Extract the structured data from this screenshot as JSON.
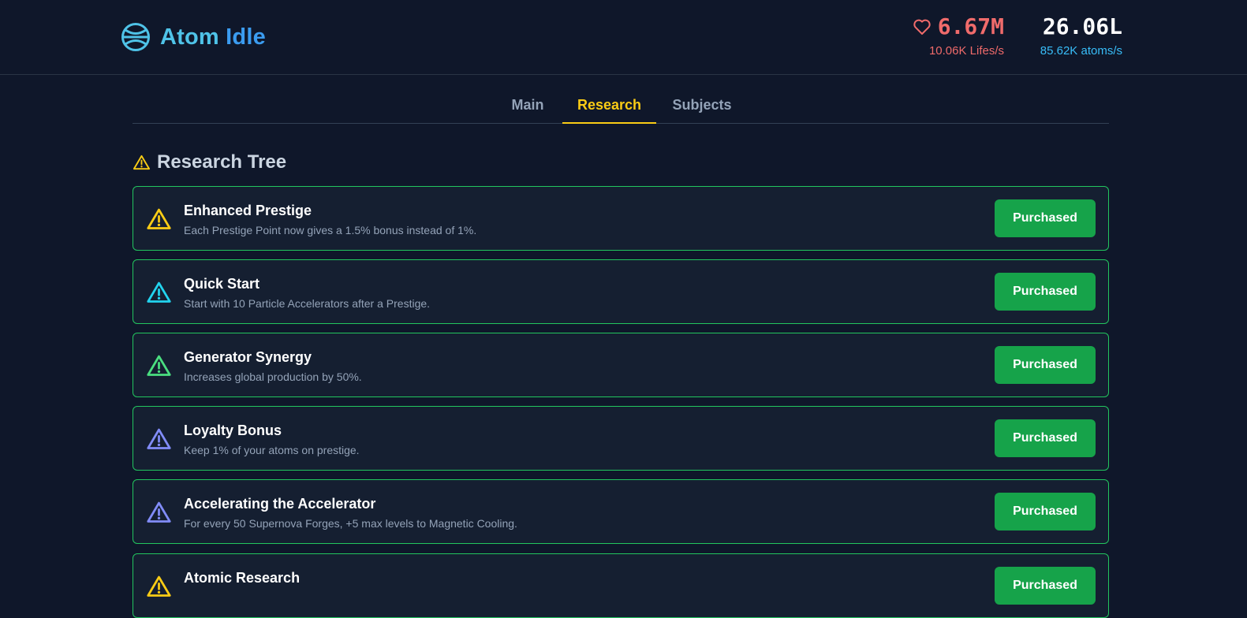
{
  "app": {
    "title_part1": "Atom",
    "title_part2": "Idle",
    "logo_icon": "atom-icon"
  },
  "stats": {
    "lives": {
      "value": "6.67M",
      "rate": "10.06K Lifes/s",
      "icon": "heart-icon",
      "color": "#f06b6b"
    },
    "atoms": {
      "value": "26.06L",
      "rate": "85.62K atoms/s",
      "color": "#38bdf8"
    }
  },
  "tabs": [
    {
      "label": "Main",
      "active": false
    },
    {
      "label": "Research",
      "active": true
    },
    {
      "label": "Subjects",
      "active": false
    }
  ],
  "section": {
    "title": "Research Tree",
    "icon": "warning-icon"
  },
  "research": [
    {
      "title": "Enhanced Prestige",
      "description": "Each Prestige Point now gives a 1.5% bonus instead of 1%.",
      "button": "Purchased",
      "icon": "warning-icon",
      "icon_color": "#facc15"
    },
    {
      "title": "Quick Start",
      "description": "Start with 10 Particle Accelerators after a Prestige.",
      "button": "Purchased",
      "icon": "warning-icon",
      "icon_color": "#22d3ee"
    },
    {
      "title": "Generator Synergy",
      "description": "Increases global production by 50%.",
      "button": "Purchased",
      "icon": "warning-icon",
      "icon_color": "#4ade80"
    },
    {
      "title": "Loyalty Bonus",
      "description": "Keep 1% of your atoms on prestige.",
      "button": "Purchased",
      "icon": "warning-icon",
      "icon_color": "#818cf8"
    },
    {
      "title": "Accelerating the Accelerator",
      "description": "For every 50 Supernova Forges, +5 max levels to Magnetic Cooling.",
      "button": "Purchased",
      "icon": "warning-icon",
      "icon_color": "#818cf8"
    },
    {
      "title": "Atomic Research",
      "description": "",
      "button": "Purchased",
      "icon": "warning-icon",
      "icon_color": "#facc15"
    }
  ],
  "colors": {
    "background": "#0f172a",
    "card_background": "#151f31",
    "card_border": "#22c55e",
    "button": "#16a34a",
    "tab_active": "#facc15"
  }
}
